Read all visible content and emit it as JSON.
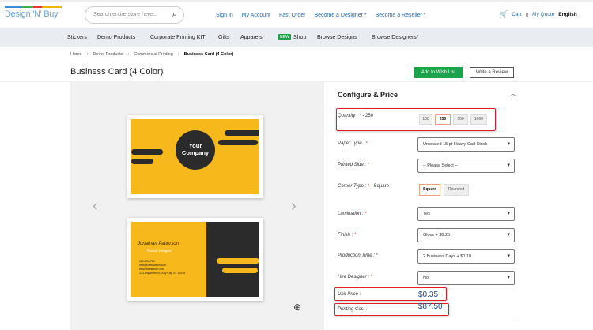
{
  "header": {
    "logo": "Design 'N' Buy",
    "search_placeholder": "Search entire store here...",
    "links": [
      "Sign In",
      "My Account",
      "Fast Order",
      "Become a Designer *",
      "Become a Reseller *"
    ],
    "cart": "Cart",
    "quote": "My Quote",
    "language": "English"
  },
  "nav": {
    "items": [
      "Stickers",
      "Demo Products",
      "Corporate Printing KIT",
      "Gifts",
      "Apparels",
      "Shop",
      "Browse Designs",
      "Browse Designers*"
    ],
    "new_badge": "NEW"
  },
  "breadcrumb": [
    "Home",
    "Demo Products",
    "Commercial Printing",
    "Business Card (4 Color)"
  ],
  "product": {
    "title": "Business Card (4 Color)",
    "wish": "Add to Wish List",
    "review": "Write a Review"
  },
  "cards": {
    "front_text": "Your Company",
    "name": "Jonathan Patterson",
    "role": "Product Designer",
    "contact": [
      "123-456-789",
      "hello@websiteurl.com",
      "www.websiteurl.com",
      "123 Anywhere St.,Any City, ST 12345"
    ]
  },
  "config": {
    "title": "Configure & Price",
    "quantity": {
      "label": "Quantity :",
      "value": "- 250",
      "options": [
        "100",
        "250",
        "500",
        "1000"
      ],
      "selected": "250"
    },
    "paper": {
      "label": "Paper Type :",
      "value": "Uncoated 15 pt Heavy Cad Stock"
    },
    "printed": {
      "label": "Printed Side :",
      "value": "-- Please Select --"
    },
    "corner": {
      "label": "Corner Type :",
      "value": "- Square",
      "options": [
        "Square",
        "Rounded"
      ],
      "selected": "Square"
    },
    "lamination": {
      "label": "Lamination :",
      "value": "Yes"
    },
    "finish": {
      "label": "Finish :",
      "value": "Gloss + $0.25"
    },
    "production": {
      "label": "Production Time :",
      "value": "2 Business Days + $0.10"
    },
    "designer": {
      "label": "Hire Designer :",
      "value": "No"
    },
    "unit_price": {
      "label": "Unit Price :",
      "value": "$0.35"
    },
    "printing_cost": {
      "label": "Printing Cost :",
      "value": "$87.50"
    }
  },
  "colors": {
    "accent_green": "#1aa34a",
    "highlight_red": "#e02020",
    "price_blue": "#1a4f9c",
    "card_yellow": "#f6b81a"
  }
}
